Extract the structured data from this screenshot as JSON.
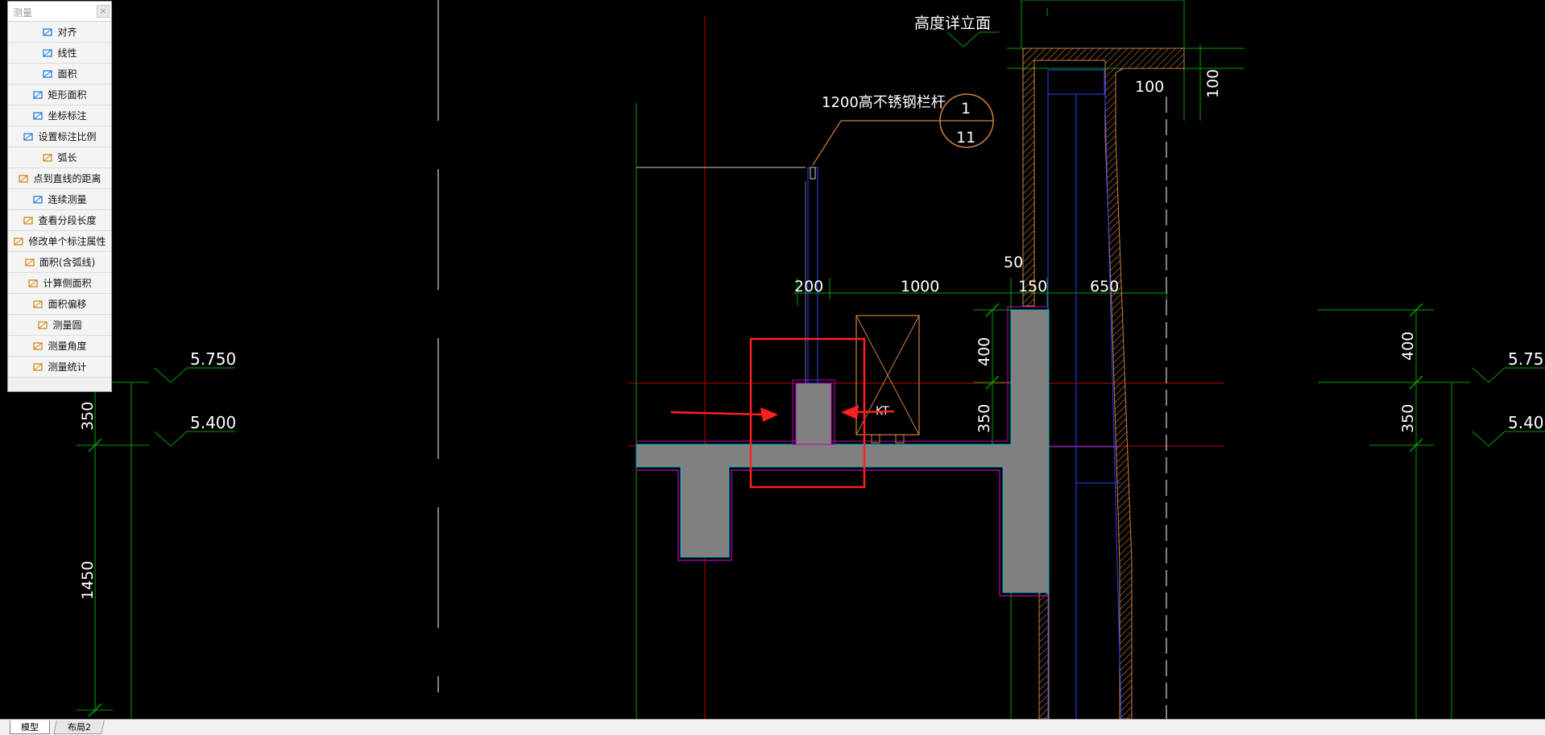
{
  "palette": {
    "title": "测量",
    "close_label": "×",
    "items": [
      {
        "label": "对齐",
        "icon": "align-dimension-icon"
      },
      {
        "label": "线性",
        "icon": "linear-dimension-icon"
      },
      {
        "label": "面积",
        "icon": "area-icon"
      },
      {
        "label": "矩形面积",
        "icon": "rect-area-icon"
      },
      {
        "label": "坐标标注",
        "icon": "coordinate-icon"
      },
      {
        "label": "设置标注比例",
        "icon": "scale-setting-icon"
      },
      {
        "label": "弧长",
        "icon": "arc-length-icon"
      },
      {
        "label": "点到直线的距离",
        "icon": "point-line-distance-icon"
      },
      {
        "label": "连续测量",
        "icon": "continuous-measure-icon"
      },
      {
        "label": "查看分段长度",
        "icon": "segment-length-icon"
      },
      {
        "label": "修改单个标注属性",
        "icon": "edit-dimension-icon"
      },
      {
        "label": "面积(含弧线)",
        "icon": "arc-area-icon"
      },
      {
        "label": "计算侧面积",
        "icon": "side-area-icon"
      },
      {
        "label": "面积偏移",
        "icon": "area-offset-icon"
      },
      {
        "label": "测量圆",
        "icon": "circle-measure-icon"
      },
      {
        "label": "测量角度",
        "icon": "angle-measure-icon"
      },
      {
        "label": "测量统计",
        "icon": "measure-stats-icon"
      }
    ]
  },
  "drawing": {
    "title_label": "高度详立面",
    "railing_note": "1200高不锈钢栏杆",
    "detail_top": "1",
    "detail_bottom": "11",
    "elev_left_upper": "5.750",
    "elev_left_lower": "5.400",
    "elev_right_upper": "5.75",
    "elev_right_lower": "5.40",
    "dim_350_left": "350",
    "dim_1450": "1450",
    "dim_200": "200",
    "dim_1000": "1000",
    "dim_50": "50",
    "dim_150": "150",
    "dim_650": "650",
    "dim_400_mid": "400",
    "dim_350_mid": "350",
    "dim_100_h": "100",
    "dim_100_v": "100",
    "dim_400_right": "400",
    "dim_350_right": "350",
    "unit_tag": "KT"
  },
  "tabs": {
    "model": "模型",
    "layout2": "布局2"
  }
}
